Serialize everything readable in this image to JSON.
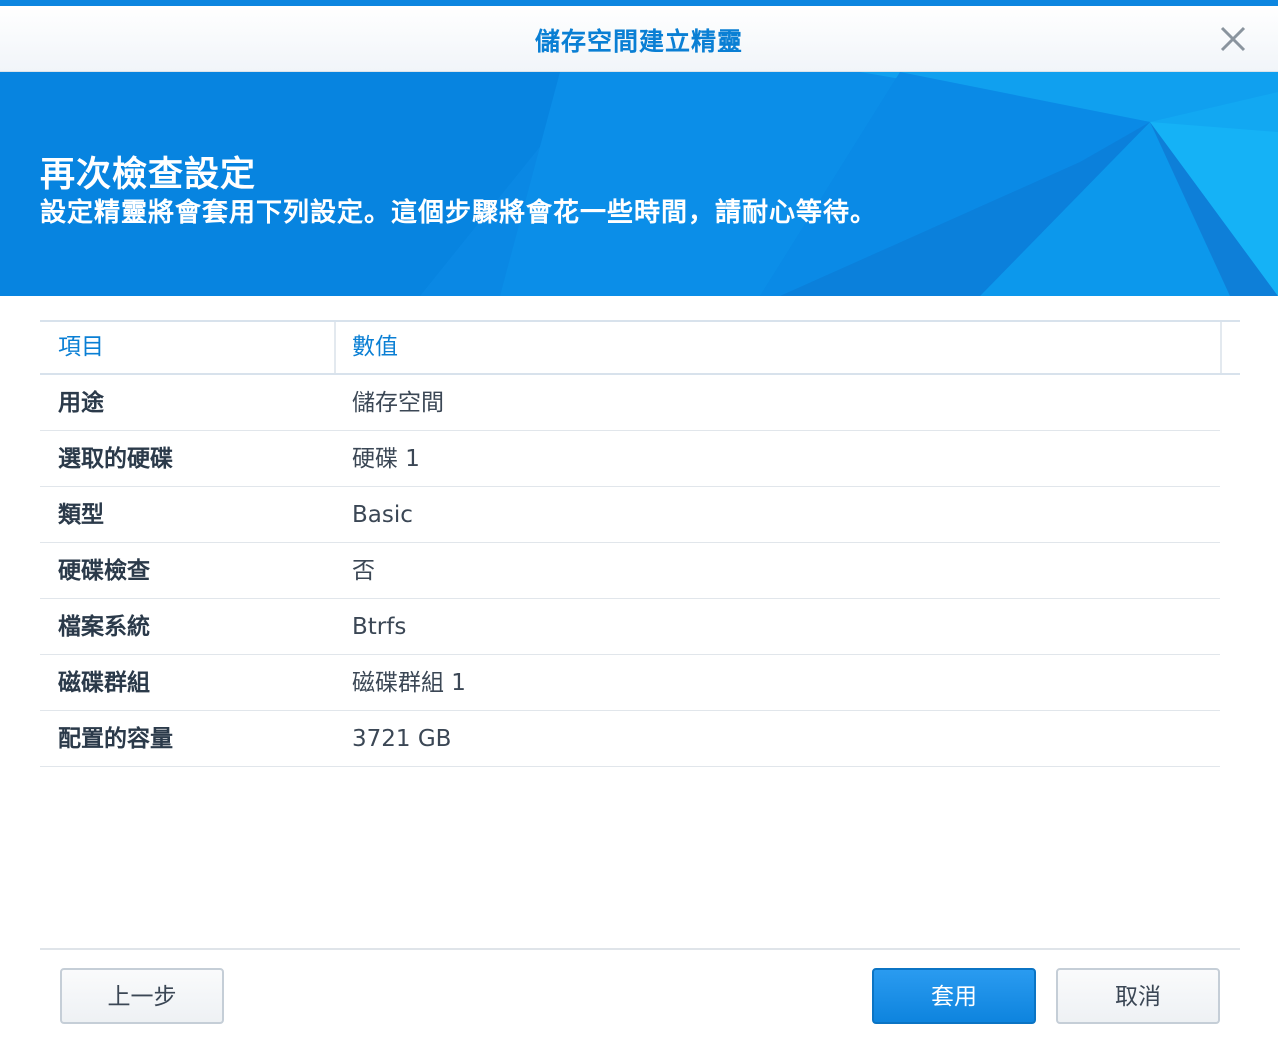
{
  "window": {
    "title": "儲存空間建立精靈"
  },
  "banner": {
    "title": "再次檢查設定",
    "subtitle": "設定精靈將會套用下列設定。這個步驟將會花一些時間，請耐心等待。"
  },
  "table": {
    "columns": [
      "項目",
      "數值"
    ],
    "rows": [
      {
        "name": "用途",
        "value": "儲存空間"
      },
      {
        "name": "選取的硬碟",
        "value": "硬碟 1"
      },
      {
        "name": "類型",
        "value": "Basic"
      },
      {
        "name": "硬碟檢查",
        "value": "否"
      },
      {
        "name": "檔案系統",
        "value": "Btrfs"
      },
      {
        "name": "磁碟群組",
        "value": "磁碟群組 1"
      },
      {
        "name": "配置的容量",
        "value": "3721 GB"
      }
    ]
  },
  "buttons": {
    "back": "上一步",
    "apply": "套用",
    "cancel": "取消"
  },
  "colors": {
    "accent": "#0a7fd4",
    "banner": "#0b8be6",
    "primary_button": "#1a8fe6"
  },
  "icons": {
    "close": "close-icon"
  }
}
